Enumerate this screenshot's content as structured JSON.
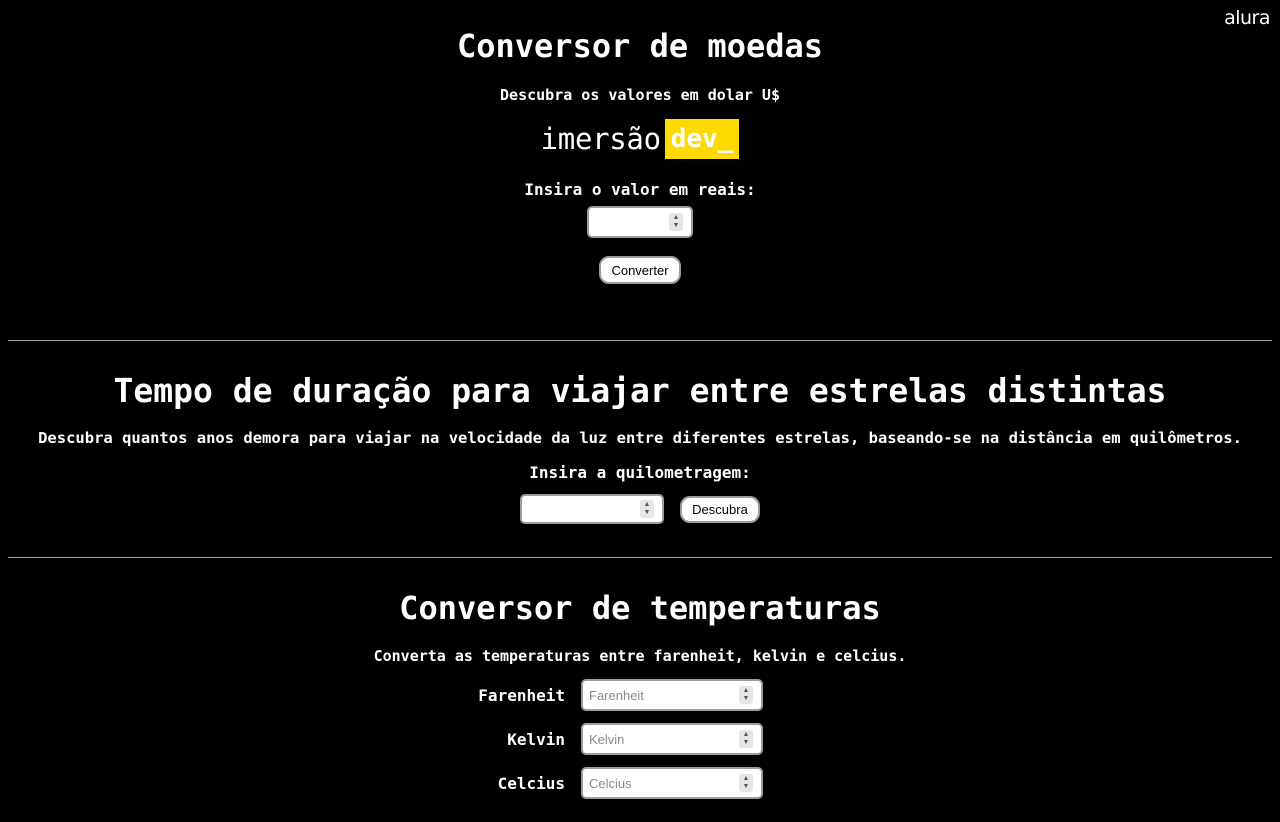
{
  "header": {
    "logo_text": "alura"
  },
  "currency": {
    "title": "Conversor de moedas",
    "subtitle": "Descubra os valores em dolar U$",
    "brand": {
      "word": "imersão",
      "highlight": "dev_"
    },
    "input_label": "Insira o valor em reais:",
    "input_value": "",
    "button_label": "Converter"
  },
  "stars": {
    "title": "Tempo de duração para viajar entre estrelas distintas",
    "subtitle": "Descubra quantos anos demora para viajar na velocidade da luz entre diferentes estrelas, baseando-se na distância em quilômetros.",
    "input_label": "Insira a quilometragem:",
    "input_value": "",
    "button_label": "Descubra"
  },
  "temperature": {
    "title": "Conversor de temperaturas",
    "subtitle": "Converta as temperaturas entre farenheit, kelvin e celcius.",
    "fields": [
      {
        "label": "Farenheit",
        "placeholder": "Farenheit"
      },
      {
        "label": "Kelvin",
        "placeholder": "Kelvin"
      },
      {
        "label": "Celcius",
        "placeholder": "Celcius"
      }
    ]
  },
  "colors": {
    "background": "#000000",
    "accent_yellow": "#ffd902",
    "text": "#ffffff"
  }
}
